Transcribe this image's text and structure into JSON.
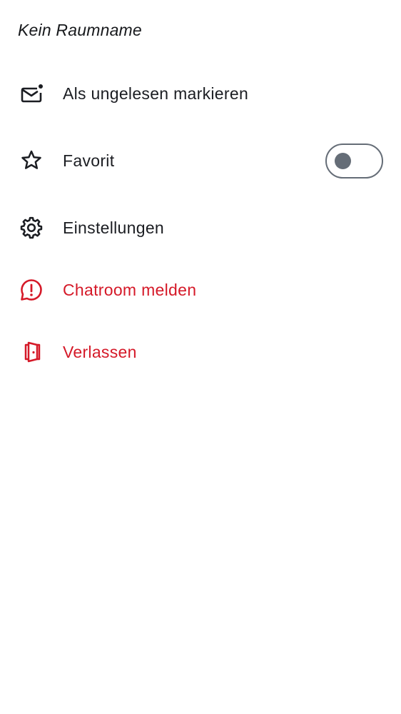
{
  "room": {
    "name": "Kein Raumname"
  },
  "menu": {
    "mark_unread": {
      "label": "Als ungelesen markieren",
      "icon": "mail-unread-icon"
    },
    "favourite": {
      "label": "Favorit",
      "icon": "star-icon",
      "toggle_on": false
    },
    "settings": {
      "label": "Einstellungen",
      "icon": "gear-icon"
    },
    "report": {
      "label": "Chatroom melden",
      "icon": "chat-report-icon"
    },
    "leave": {
      "label": "Verlassen",
      "icon": "door-leave-icon"
    }
  },
  "colors": {
    "text": "#1b1d22",
    "critical": "#d51928",
    "toggle_off": "#656d77",
    "background": "#ffffff"
  }
}
